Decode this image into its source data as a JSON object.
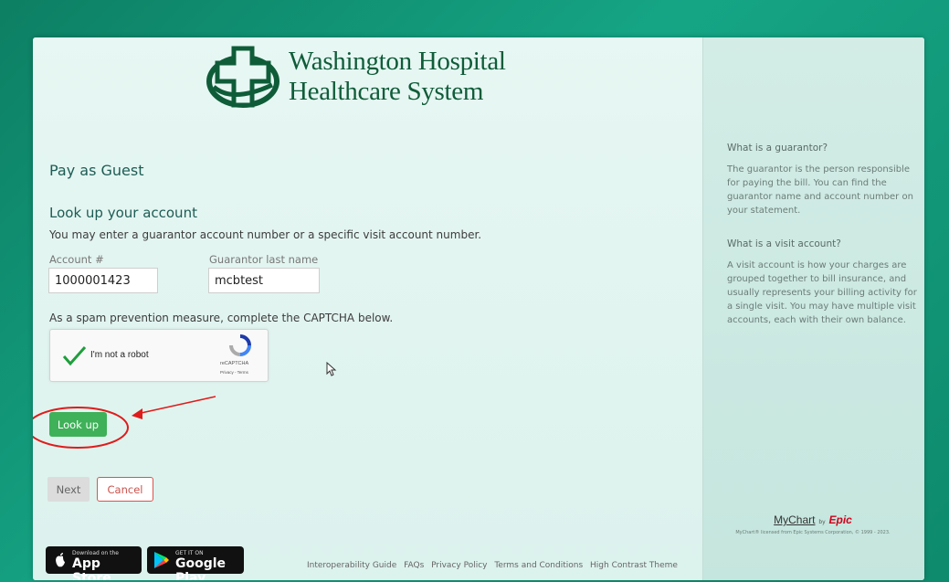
{
  "logo": {
    "line1": "Washington Hospital",
    "line2": "Healthcare System"
  },
  "page_title": "Pay as Guest",
  "section_title": "Look up your account",
  "instruction": "You may enter a guarantor account number or a specific visit account number.",
  "fields": {
    "account": {
      "label": "Account #",
      "value": "1000001423"
    },
    "lastname": {
      "label": "Guarantor last name",
      "value": "mcbtest"
    }
  },
  "captcha": {
    "prompt": "As a spam prevention measure, complete the CAPTCHA below.",
    "checkbox_label": "I'm not a robot",
    "brand": "reCAPTCHA",
    "links": "Privacy - Terms",
    "checked": true
  },
  "buttons": {
    "lookup": "Look up",
    "next": "Next",
    "cancel": "Cancel"
  },
  "app_store": {
    "small": "Download on the",
    "big": "App Store"
  },
  "google_play": {
    "small": "GET IT ON",
    "big": "Google Play"
  },
  "footer_links": [
    "Interoperability Guide",
    "FAQs",
    "Privacy Policy",
    "Terms and Conditions",
    "High Contrast Theme"
  ],
  "sidebar": {
    "q1_title": "What is a guarantor?",
    "q1_text": "The guarantor is the person responsible for paying the bill. You can find the guarantor name and account number on your statement.",
    "q2_title": "What is a visit account?",
    "q2_text": "A visit account is how your charges are grouped together to bill insurance, and usually represents your billing activity for a single visit. You may have multiple visit accounts, each with their own balance."
  },
  "mychart": {
    "brand": "MyChart",
    "by": "by",
    "epic": "Epic",
    "license": "MyChart® licensed from Epic Systems Corporation, © 1999 - 2023."
  },
  "colors": {
    "accent_green": "#3fb159",
    "heading_teal": "#1d5c54",
    "logo_green": "#0f5c39",
    "annotation_red": "#e01b1b"
  }
}
